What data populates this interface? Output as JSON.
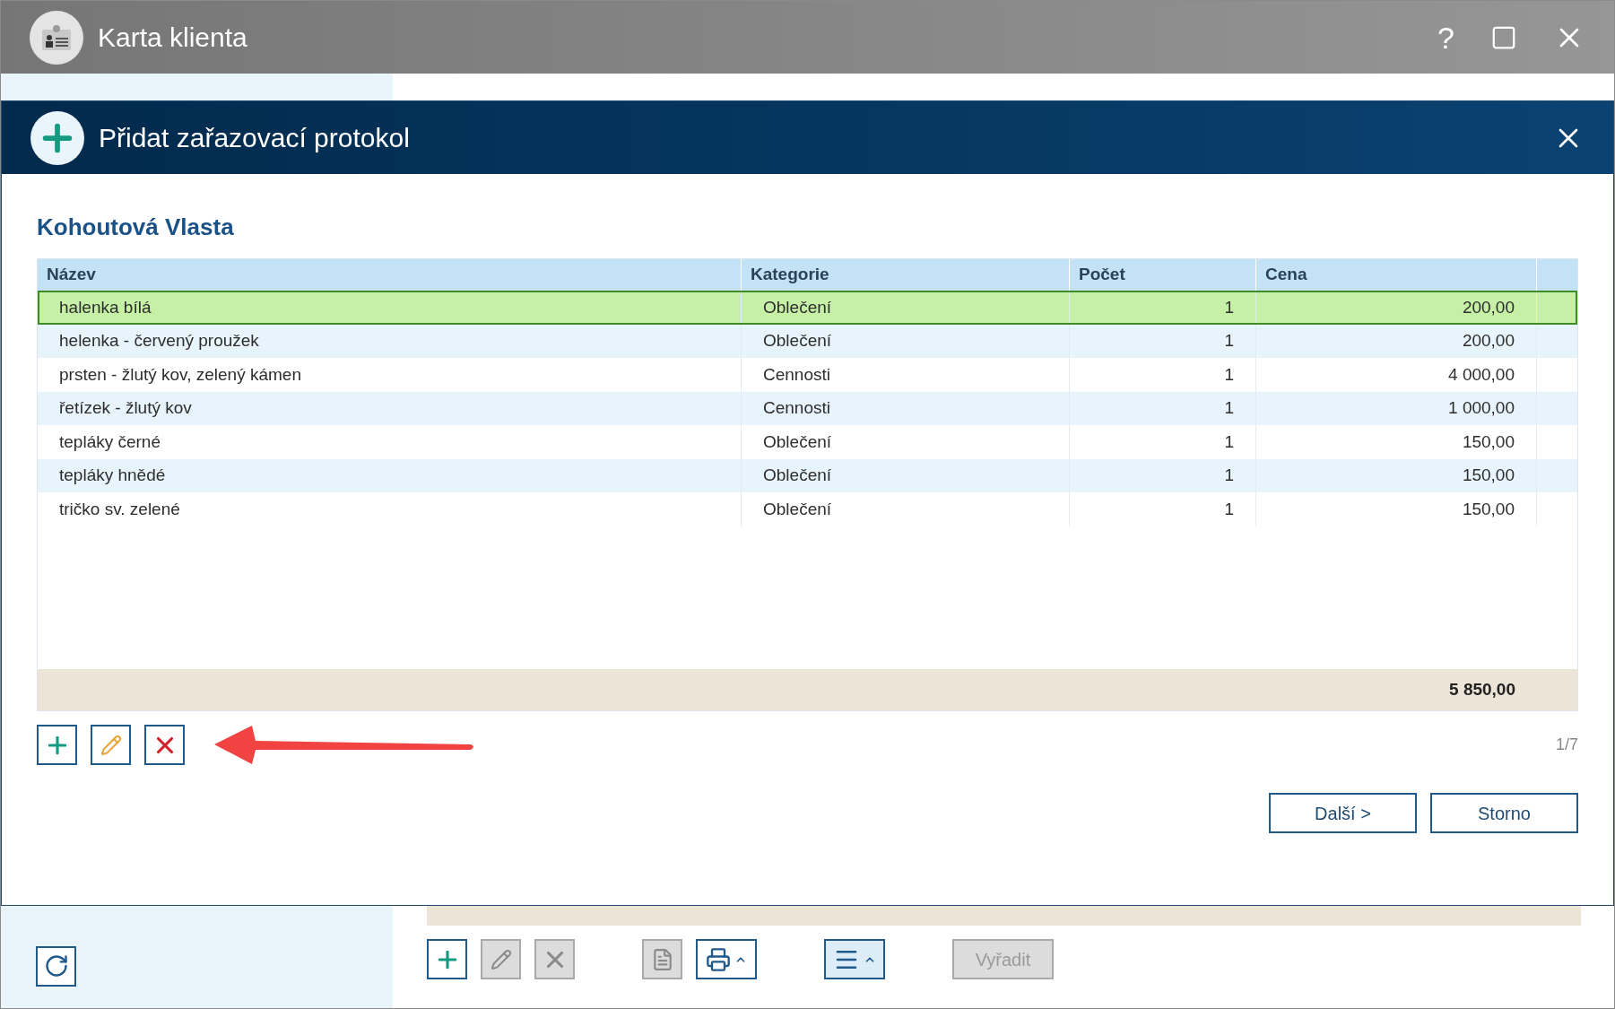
{
  "window": {
    "title": "Karta klienta",
    "help_label": "?"
  },
  "dialog": {
    "title": "Přidat zařazovací protokol",
    "client_name": "Kohoutová Vlasta",
    "table": {
      "columns": [
        "Název",
        "Kategorie",
        "Počet",
        "Cena"
      ],
      "rows": [
        {
          "name": "halenka bílá",
          "category": "Oblečení",
          "count": "1",
          "price": "200,00",
          "selected": true
        },
        {
          "name": "helenka - červený proužek",
          "category": "Oblečení",
          "count": "1",
          "price": "200,00",
          "selected": false
        },
        {
          "name": "prsten - žlutý kov, zelený kámen",
          "category": "Cennosti",
          "count": "1",
          "price": "4 000,00",
          "selected": false
        },
        {
          "name": "řetízek - žlutý kov",
          "category": "Cennosti",
          "count": "1",
          "price": "1 000,00",
          "selected": false
        },
        {
          "name": "tepláky černé",
          "category": "Oblečení",
          "count": "1",
          "price": "150,00",
          "selected": false
        },
        {
          "name": "tepláky hnědé",
          "category": "Oblečení",
          "count": "1",
          "price": "150,00",
          "selected": false
        },
        {
          "name": "tričko sv. zelené",
          "category": "Oblečení",
          "count": "1",
          "price": "150,00",
          "selected": false
        }
      ],
      "total": "5 850,00"
    },
    "row_tools": [
      {
        "kind": "add",
        "disabled": false
      },
      {
        "kind": "edit",
        "disabled": false
      },
      {
        "kind": "delete",
        "disabled": false
      }
    ],
    "page_indicator": "1/7",
    "buttons": [
      "Další >",
      "Storno"
    ]
  },
  "toolbar": {
    "tools": [
      {
        "kind": "add",
        "disabled": false
      },
      {
        "kind": "edit",
        "disabled": true
      },
      {
        "kind": "delete",
        "disabled": true
      },
      {
        "kind": "document",
        "disabled": true
      },
      {
        "kind": "print",
        "disabled": false
      },
      {
        "kind": "menu",
        "disabled": false
      }
    ],
    "discard_button": {
      "label": "Vyřadit",
      "disabled": true
    }
  }
}
